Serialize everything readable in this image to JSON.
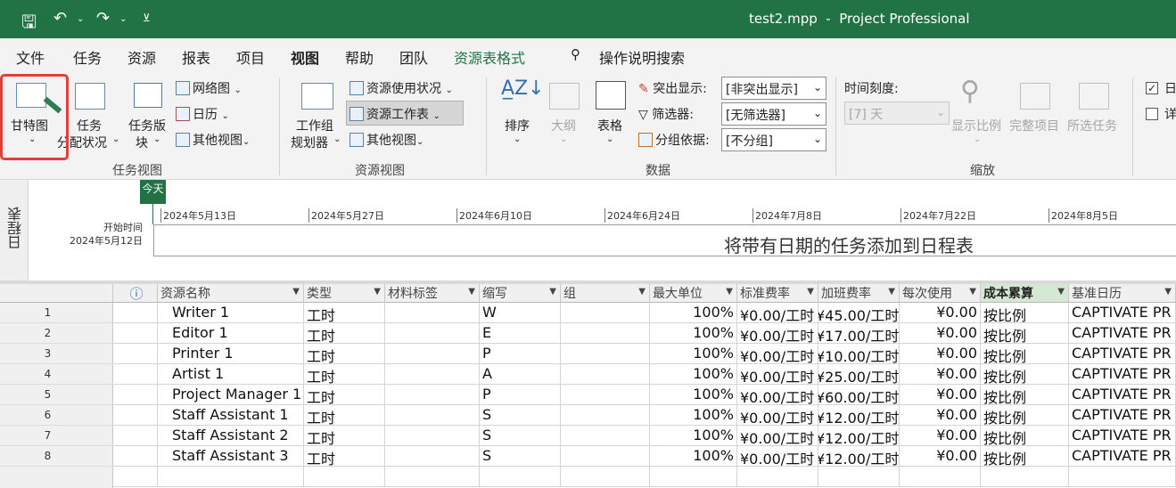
{
  "titlebar": {
    "title": "test2.mpp  -  Project Professional",
    "save_icon": "save-icon",
    "undo_icon": "undo-icon",
    "redo_icon": "redo-icon",
    "customize_icon": "customize-qat-icon"
  },
  "menu": {
    "items": [
      "文件",
      "任务",
      "资源",
      "报表",
      "项目",
      "视图",
      "帮助",
      "团队",
      "资源表格式"
    ],
    "active": "视图",
    "search_label": "操作说明搜索"
  },
  "ribbon": {
    "task_views": {
      "group_label": "任务视图",
      "gantt": "甘特图",
      "task_usage_1": "任务",
      "task_usage_2": "分配状况",
      "task_board_1": "任务版",
      "task_board_2": "块",
      "network": "网络图",
      "calendar": "日历",
      "other": "其他视图"
    },
    "resource_views": {
      "group_label": "资源视图",
      "team_planner_1": "工作组",
      "team_planner_2": "规划器",
      "resource_usage": "资源使用状况",
      "resource_sheet": "资源工作表",
      "other": "其他视图"
    },
    "data": {
      "group_label": "数据",
      "sort": "排序",
      "outline": "大纲",
      "tables": "表格",
      "highlight_label": "突出显示:",
      "highlight_value": "[非突出显示]",
      "filter_label": "筛选器:",
      "filter_value": "[无筛选器]",
      "group_label2": "分组依据:",
      "group_value": "[不分组]"
    },
    "zoom": {
      "group_label": "缩放",
      "timescale_label": "时间刻度:",
      "timescale_value": "[7] 天",
      "zoom": "显示比例",
      "entire_project": "完整项目",
      "selected_tasks": "所选任务"
    },
    "split": {
      "timeline_check": "日",
      "details_check": "详"
    }
  },
  "timeline": {
    "side_label": "日程表",
    "today": "今天",
    "start_label": "开始时间",
    "start_date": "2024年5月12日",
    "ticks": [
      "2024年5月13日",
      "2024年5月27日",
      "2024年6月10日",
      "2024年6月24日",
      "2024年7月8日",
      "2024年7月22日",
      "2024年8月5日"
    ],
    "message": "将带有日期的任务添加到日程表"
  },
  "grid": {
    "info_icon": "info-icon",
    "headers": [
      "资源名称",
      "类型",
      "材料标签",
      "缩写",
      "组",
      "最大单位",
      "标准费率",
      "加班费率",
      "每次使用",
      "成本累算",
      "基准日历"
    ],
    "selected_header": "成本累算",
    "rows": [
      {
        "n": "1",
        "name": "Writer 1",
        "type": "工时",
        "mat": "",
        "abbr": "W",
        "grp": "",
        "max": "100%",
        "std": "¥0.00/工时",
        "ovt": "¥45.00/工时",
        "per": "¥0.00",
        "acc": "按比例",
        "cal": "CAPTIVATE PR"
      },
      {
        "n": "2",
        "name": "Editor 1",
        "type": "工时",
        "mat": "",
        "abbr": "E",
        "grp": "",
        "max": "100%",
        "std": "¥0.00/工时",
        "ovt": "¥17.00/工时",
        "per": "¥0.00",
        "acc": "按比例",
        "cal": "CAPTIVATE PR"
      },
      {
        "n": "3",
        "name": "Printer 1",
        "type": "工时",
        "mat": "",
        "abbr": "P",
        "grp": "",
        "max": "100%",
        "std": "¥0.00/工时",
        "ovt": "¥10.00/工时",
        "per": "¥0.00",
        "acc": "按比例",
        "cal": "CAPTIVATE PR"
      },
      {
        "n": "4",
        "name": "Artist 1",
        "type": "工时",
        "mat": "",
        "abbr": "A",
        "grp": "",
        "max": "100%",
        "std": "¥0.00/工时",
        "ovt": "¥25.00/工时",
        "per": "¥0.00",
        "acc": "按比例",
        "cal": "CAPTIVATE PR"
      },
      {
        "n": "5",
        "name": "Project Manager 1",
        "type": "工时",
        "mat": "",
        "abbr": "P",
        "grp": "",
        "max": "100%",
        "std": "¥0.00/工时",
        "ovt": "¥60.00/工时",
        "per": "¥0.00",
        "acc": "按比例",
        "cal": "CAPTIVATE PR"
      },
      {
        "n": "6",
        "name": "Staff Assistant 1",
        "type": "工时",
        "mat": "",
        "abbr": "S",
        "grp": "",
        "max": "100%",
        "std": "¥0.00/工时",
        "ovt": "¥12.00/工时",
        "per": "¥0.00",
        "acc": "按比例",
        "cal": "CAPTIVATE PR"
      },
      {
        "n": "7",
        "name": "Staff Assistant 2",
        "type": "工时",
        "mat": "",
        "abbr": "S",
        "grp": "",
        "max": "100%",
        "std": "¥0.00/工时",
        "ovt": "¥12.00/工时",
        "per": "¥0.00",
        "acc": "按比例",
        "cal": "CAPTIVATE PR"
      },
      {
        "n": "8",
        "name": "Staff Assistant 3",
        "type": "工时",
        "mat": "",
        "abbr": "S",
        "grp": "",
        "max": "100%",
        "std": "¥0.00/工时",
        "ovt": "¥12.00/工时",
        "per": "¥0.00",
        "acc": "按比例",
        "cal": "CAPTIVATE PR"
      }
    ]
  },
  "colors": {
    "brand": "#217346",
    "highlight_box": "#e0403a",
    "selected_header": "#d5e8d4"
  }
}
